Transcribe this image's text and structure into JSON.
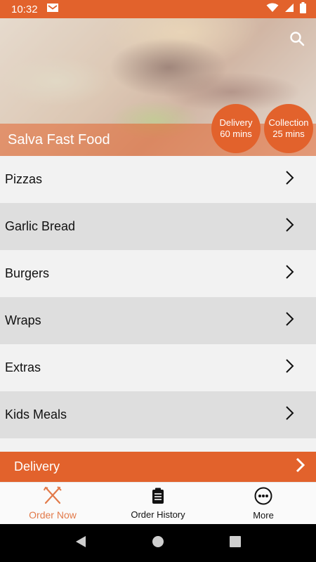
{
  "status_bar": {
    "time": "10:32",
    "icons": [
      "mail-icon",
      "wifi-icon",
      "signal-icon",
      "battery-icon"
    ]
  },
  "hero": {
    "title": "Salva Fast Food",
    "search_icon": "search-icon",
    "delivery_badge": {
      "label": "Delivery",
      "time": "60 mins"
    },
    "collection_badge": {
      "label": "Collection",
      "time": "25 mins"
    }
  },
  "menu": {
    "items": [
      {
        "label": "Pizzas"
      },
      {
        "label": "Garlic Bread"
      },
      {
        "label": "Burgers"
      },
      {
        "label": "Wraps"
      },
      {
        "label": "Extras"
      },
      {
        "label": "Kids Meals"
      }
    ]
  },
  "delivery_bar": {
    "label": "Delivery"
  },
  "bottom_nav": {
    "items": [
      {
        "label": "Order Now",
        "icon": "fork-knife-icon",
        "active": true
      },
      {
        "label": "Order History",
        "icon": "clipboard-icon",
        "active": false
      },
      {
        "label": "More",
        "icon": "more-icon",
        "active": false
      }
    ]
  },
  "colors": {
    "accent": "#e2622c",
    "active_nav": "#e27a4a",
    "row_light": "#f2f2f2",
    "row_dark": "#dedede"
  }
}
